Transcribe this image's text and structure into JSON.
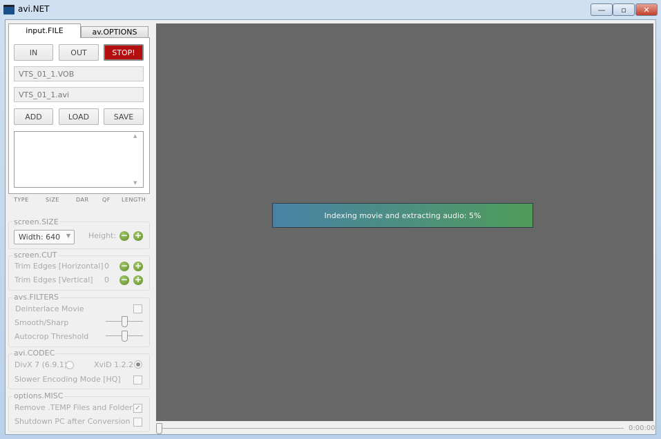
{
  "window": {
    "title": "avi.NET",
    "minimize": "—",
    "maximize": "▫",
    "close": "✕"
  },
  "tabs": [
    {
      "label": "input.FILE",
      "active": true
    },
    {
      "label": "av.OPTIONS",
      "active": false
    }
  ],
  "file": {
    "in": "IN",
    "out": "OUT",
    "stop": "STOP!",
    "input_value": "VTS_01_1.VOB",
    "output_value": "VTS_01_1.avi",
    "add": "ADD",
    "load": "LOAD",
    "save": "SAVE",
    "columns": [
      "TYPE",
      "SIZE",
      "DAR",
      "QF",
      "LENGTH"
    ]
  },
  "screen_size": {
    "title": "screen.SIZE",
    "width_select": "Width: 640",
    "height_label": "Height:"
  },
  "screen_cut": {
    "title": "screen.CUT",
    "rows": [
      {
        "label": "Trim Edges [Horizontal]",
        "value": "0"
      },
      {
        "label": "Trim Edges [Vertical]",
        "value": "0"
      }
    ]
  },
  "filters": {
    "title": "avs.FILTERS",
    "deinterlace": "Deinterlace Movie",
    "deinterlace_checked": false,
    "smooth": "Smooth/Sharp",
    "smooth_level": 0.5,
    "autocrop": "Autocrop Threshold",
    "autocrop_level": 0.5
  },
  "codec": {
    "title": "avi.CODEC",
    "divx": "DivX 7 (6.9.1)",
    "xvid": "XviD 1.2.2",
    "selected": "XviD 1.2.2",
    "slower": "Slower Encoding Mode [HQ]",
    "slower_checked": false
  },
  "misc": {
    "title": "options.MISC",
    "remove_temp": "Remove .TEMP Files and Folder",
    "remove_temp_checked": true,
    "shutdown": "Shutdown PC after Conversion",
    "shutdown_checked": false
  },
  "progress": {
    "text": "Indexing movie and extracting audio: 5%",
    "percent": 5,
    "colors": [
      "#4a82a6",
      "#4f9b5a"
    ]
  },
  "player": {
    "time": "0:00:00",
    "position": 0
  }
}
